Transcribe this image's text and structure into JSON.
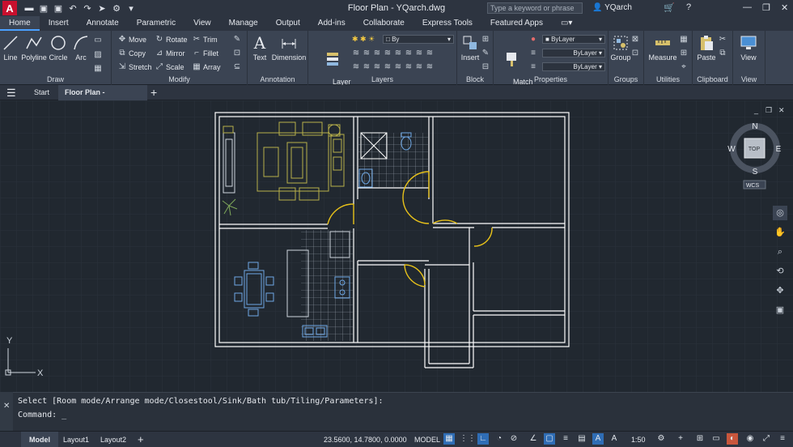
{
  "app": {
    "logo": "A",
    "title": "Floor Plan - YQarch.dwg"
  },
  "titlebar": {
    "search_placeholder": "Type a keyword or phrase",
    "user": "YQarch"
  },
  "ribbon_tabs": [
    "Home",
    "Insert",
    "Annotate",
    "Parametric",
    "View",
    "Manage",
    "Output",
    "Add-ins",
    "Collaborate",
    "Express Tools",
    "Featured Apps"
  ],
  "draw": {
    "label": "Draw",
    "line": "Line",
    "polyline": "Polyline",
    "circle": "Circle",
    "arc": "Arc"
  },
  "modify": {
    "label": "Modify",
    "move": "Move",
    "rotate": "Rotate",
    "trim": "Trim",
    "copy": "Copy",
    "mirror": "Mirror",
    "fillet": "Fillet",
    "stretch": "Stretch",
    "scale": "Scale",
    "array": "Array"
  },
  "annotation": {
    "label": "Annotation",
    "text": "Text",
    "dimension": "Dimension"
  },
  "layers": {
    "label": "Layers",
    "layer_properties": "Layer\nProperties",
    "current_layer": "By"
  },
  "block": {
    "label": "Block",
    "insert": "Insert"
  },
  "properties": {
    "label": "Properties",
    "match": "Match\nProperties",
    "color": "ByLayer",
    "linetype": "ByLayer",
    "lineweight": "ByLayer"
  },
  "groups": {
    "label": "Groups",
    "group": "Group"
  },
  "utilities": {
    "label": "Utilities",
    "measure": "Measure"
  },
  "clipboard": {
    "label": "Clipboard",
    "paste": "Paste"
  },
  "view_panel": {
    "label": "View",
    "view": "View"
  },
  "file_tabs": {
    "start": "Start",
    "active": "Floor Plan - YQarch*"
  },
  "viewcube": {
    "n": "N",
    "s": "S",
    "e": "E",
    "w": "W",
    "top": "TOP",
    "wcs": "WCS"
  },
  "ucs": {
    "x": "X",
    "y": "Y"
  },
  "command": {
    "prompt": "Select [Room mode/Arrange mode/Closestool/Sink/Bath tub/Tiling/Parameters]:",
    "input": "Command: _"
  },
  "status": {
    "model_tab": "Model",
    "layout1": "Layout1",
    "layout2": "Layout2",
    "coords": "23.5600, 14.7800, 0.0000",
    "space": "MODEL",
    "scale": "1:50"
  },
  "colors": {
    "wall": "#ffffff",
    "furniture": "#b8b04a",
    "fixture": "#6ea8e6",
    "door": "#e8c21a",
    "grid": "#2a323c"
  }
}
